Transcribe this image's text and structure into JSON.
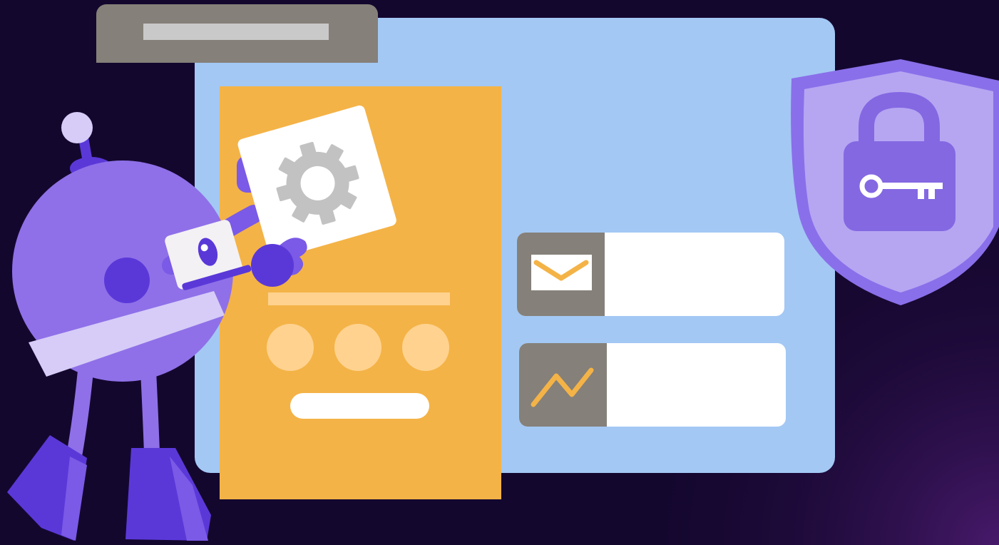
{
  "colors": {
    "background": "#14072e",
    "background_glow": "#4a1a6e",
    "window_body": "#a3c8f4",
    "title_bar": "#858079",
    "title_bar_placeholder": "#c9c9c9",
    "orange_panel": "#f4b347",
    "orange_light": "#ffd28f",
    "card_white": "#ffffff",
    "card_icon_bg": "#858079",
    "accent_orange": "#f4b347",
    "gear_gray": "#c2c2c2",
    "shield_outer": "#8a6fea",
    "shield_inner": "#b6a6f2",
    "lock_body": "#8468e2",
    "robot_body": "#8f70e8",
    "robot_dark": "#5a38d8",
    "robot_band": "#d6ccf7",
    "robot_eye_panel": "#f3f1f4"
  },
  "icons": {
    "settings_card": "gear-icon",
    "mail_card": "envelope-icon",
    "chart_card": "trend-line-icon",
    "shield": "shield-lock-icon",
    "key": "key-icon"
  },
  "illustration": {
    "subject": "robot-mascot",
    "dot_count": 3,
    "cards": [
      "mail-card",
      "chart-card"
    ]
  }
}
